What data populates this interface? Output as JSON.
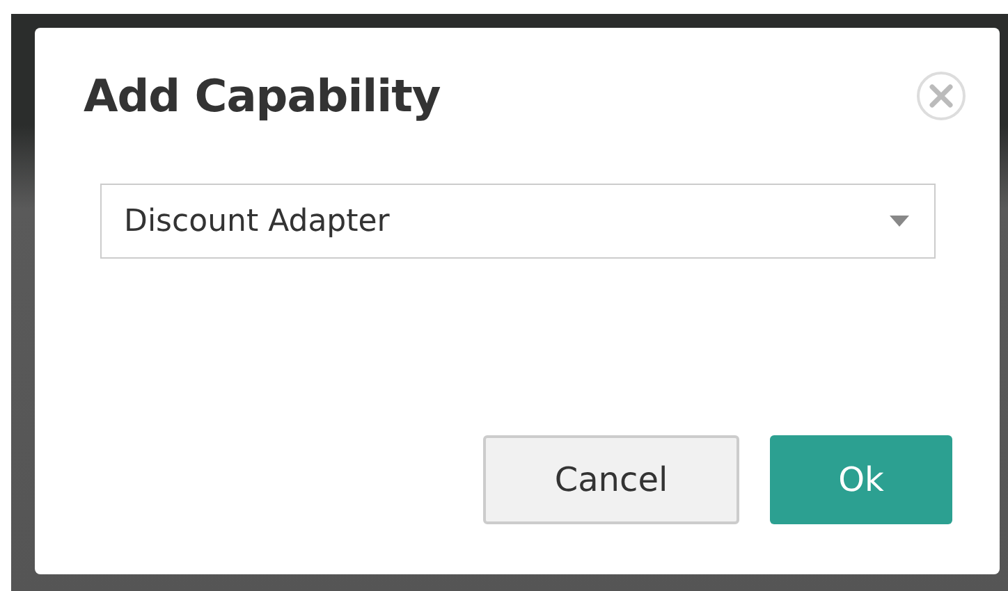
{
  "dialog": {
    "title": "Add Capability",
    "select": {
      "value": "Discount Adapter"
    },
    "buttons": [
      {
        "label": "Cancel",
        "kind": "secondary"
      },
      {
        "label": "Ok",
        "kind": "primary"
      }
    ]
  }
}
